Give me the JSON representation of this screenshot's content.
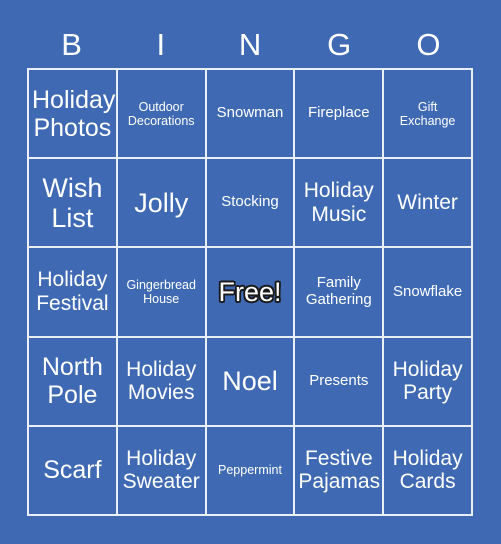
{
  "card": {
    "background_color": "#3f6ab3",
    "grid_line_color": "#e9eef7",
    "text_color": "#ffffff",
    "header_letters": [
      "B",
      "I",
      "N",
      "G",
      "O"
    ],
    "rows": 5,
    "columns": 5,
    "cells": [
      [
        {
          "label": "Holiday\nPhotos",
          "size": "lg",
          "free": false
        },
        {
          "label": "Outdoor\nDecorations",
          "size": "xxs",
          "free": false
        },
        {
          "label": "Snowman",
          "size": "xs",
          "free": false
        },
        {
          "label": "Fireplace",
          "size": "xs",
          "free": false
        },
        {
          "label": "Gift\nExchange",
          "size": "xxs",
          "free": false
        }
      ],
      [
        {
          "label": "Wish\nList",
          "size": "xl",
          "free": false
        },
        {
          "label": "Jolly",
          "size": "xl",
          "free": false
        },
        {
          "label": "Stocking",
          "size": "xs",
          "free": false
        },
        {
          "label": "Holiday\nMusic",
          "size": "md",
          "free": false
        },
        {
          "label": "Winter",
          "size": "md",
          "free": false
        }
      ],
      [
        {
          "label": "Holiday\nFestival",
          "size": "md",
          "free": false
        },
        {
          "label": "Gingerbread\nHouse",
          "size": "xxs",
          "free": false
        },
        {
          "label": "Free!",
          "size": "xl",
          "free": true
        },
        {
          "label": "Family\nGathering",
          "size": "xs",
          "free": false
        },
        {
          "label": "Snowflake",
          "size": "xs",
          "free": false
        }
      ],
      [
        {
          "label": "North\nPole",
          "size": "lg",
          "free": false
        },
        {
          "label": "Holiday\nMovies",
          "size": "md",
          "free": false
        },
        {
          "label": "Noel",
          "size": "xl",
          "free": false
        },
        {
          "label": "Presents",
          "size": "xs",
          "free": false
        },
        {
          "label": "Holiday\nParty",
          "size": "md",
          "free": false
        }
      ],
      [
        {
          "label": "Scarf",
          "size": "lg",
          "free": false
        },
        {
          "label": "Holiday\nSweater",
          "size": "md",
          "free": false
        },
        {
          "label": "Peppermint",
          "size": "xxs",
          "free": false
        },
        {
          "label": "Festive\nPajamas",
          "size": "md",
          "free": false
        },
        {
          "label": "Holiday\nCards",
          "size": "md",
          "free": false
        }
      ]
    ]
  }
}
